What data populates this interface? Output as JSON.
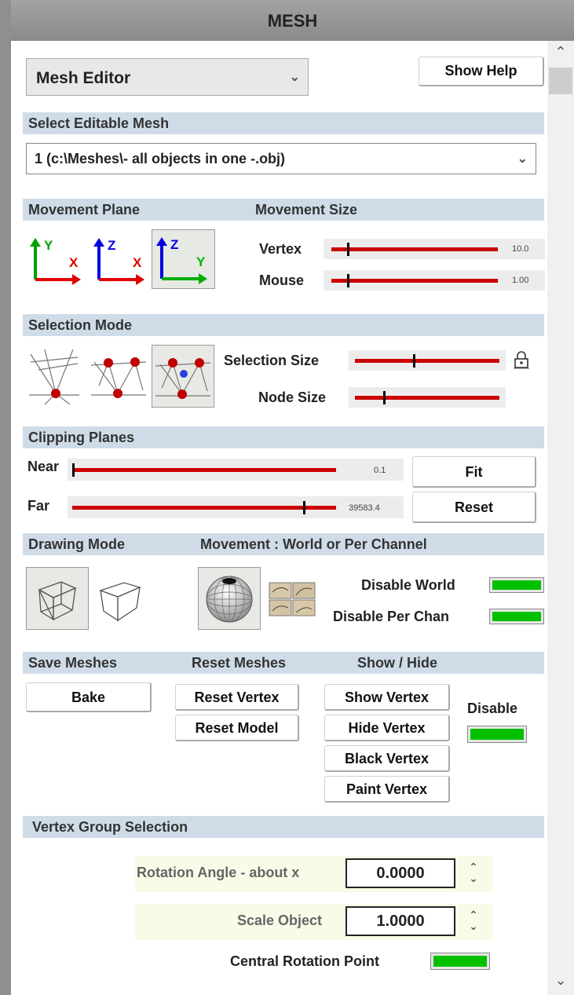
{
  "title": "MESH",
  "editor_select": {
    "value": "Mesh Editor"
  },
  "show_help_label": "Show Help",
  "select_mesh": {
    "header": "Select Editable Mesh",
    "value": "1 (c:\\Meshes\\- all objects in one -.obj)"
  },
  "movement": {
    "plane_header": "Movement Plane",
    "size_header": "Movement Size",
    "planes": [
      {
        "name": "xy-plane-icon",
        "axis_up": "Y",
        "axis_right": "X",
        "selected": false
      },
      {
        "name": "xz-plane-icon",
        "axis_up": "Z",
        "axis_right": "X",
        "selected": false
      },
      {
        "name": "yz-plane-icon",
        "axis_up": "Z",
        "axis_right": "Y",
        "selected": true
      }
    ],
    "vertex": {
      "label": "Vertex",
      "value": "10.0"
    },
    "mouse": {
      "label": "Mouse",
      "value": "1.00"
    }
  },
  "selection": {
    "header": "Selection Mode",
    "size_label": "Selection Size",
    "node_size_label": "Node Size"
  },
  "clipping": {
    "header": "Clipping Planes",
    "near": {
      "label": "Near",
      "value": "0.1"
    },
    "far": {
      "label": "Far",
      "value": "39583.4"
    },
    "fit_label": "Fit",
    "reset_label": "Reset"
  },
  "drawing": {
    "header": "Drawing Mode",
    "movement_header": "Movement : World or Per Channel",
    "disable_world": "Disable World",
    "disable_per_chan": "Disable Per Chan"
  },
  "meshes": {
    "save_header": "Save Meshes",
    "reset_header": "Reset Meshes",
    "show_hide_header": "Show / Hide",
    "bake": "Bake",
    "reset_vertex": "Reset Vertex",
    "reset_model": "Reset Model",
    "show_vertex": "Show Vertex",
    "hide_vertex": "Hide Vertex",
    "black_vertex": "Black Vertex",
    "paint_vertex": "Paint Vertex",
    "disable": "Disable"
  },
  "vertex_group": {
    "header": "Vertex Group Selection",
    "rotation_label": "Rotation Angle - about x",
    "rotation_value": "0.0000",
    "scale_label": "Scale Object",
    "scale_value": "1.0000",
    "central_label": "Central Rotation Point"
  },
  "colors": {
    "accent_red": "#cc0000",
    "toggle_green": "#00c000",
    "section_bg": "#cfdce8"
  }
}
